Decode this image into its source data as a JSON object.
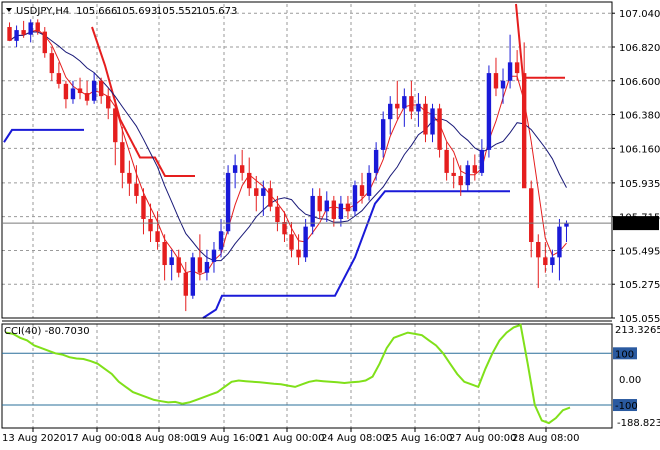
{
  "header": {
    "symbol": "USDJPY,H4",
    "open": "105.666",
    "high": "105.693",
    "low": "105.552",
    "close": "105.673"
  },
  "indicator": {
    "label": "CCI(40) -80.7030",
    "scale_top": "213.3265",
    "scale_bottom": "-188.8236",
    "levels": [
      {
        "text": "100",
        "value": 100,
        "marked": true
      },
      {
        "text": "0.00",
        "value": 0,
        "marked": false
      },
      {
        "text": "-100",
        "value": -100,
        "marked": true
      }
    ]
  },
  "price_axis": {
    "ticks": [
      "107.040",
      "106.820",
      "106.600",
      "106.380",
      "106.160",
      "105.935",
      "105.715",
      "105.495",
      "105.275",
      "105.055"
    ],
    "current_price": "105.673",
    "current_value": 105.673
  },
  "time_axis": {
    "labels": [
      "13 Aug 2020",
      "17 Aug 00:00",
      "18 Aug 08:00",
      "19 Aug 16:00",
      "21 Aug 00:00",
      "24 Aug 08:00",
      "25 Aug 16:00",
      "27 Aug 00:00",
      "28 Aug 08:00"
    ]
  },
  "colors": {
    "bull": "#1a1ad8",
    "bear": "#e51e1e",
    "ma_fast": "#e51e1e",
    "ma_slow": "#1a1a78",
    "stop_red": "#e51e1e",
    "stop_blue": "#1a1ad8",
    "cci": "#80e01a",
    "grid": "#9a9a9a",
    "level_line": "#2a6f9a",
    "marker_bg": "#2a5aa0"
  },
  "chart_data": {
    "type": "candlestick",
    "ylim": [
      105.055,
      107.1
    ],
    "candles": [
      [
        106.95,
        106.98,
        106.9,
        106.86
      ],
      [
        106.86,
        106.96,
        106.82,
        106.93
      ],
      [
        106.93,
        106.99,
        106.88,
        106.9
      ],
      [
        106.9,
        107.0,
        106.85,
        106.98
      ],
      [
        106.98,
        107.0,
        106.9,
        106.92
      ],
      [
        106.92,
        106.95,
        106.75,
        106.78
      ],
      [
        106.78,
        106.82,
        106.6,
        106.65
      ],
      [
        106.65,
        106.72,
        106.55,
        106.58
      ],
      [
        106.58,
        106.6,
        106.42,
        106.48
      ],
      [
        106.48,
        106.6,
        106.45,
        106.55
      ],
      [
        106.55,
        106.62,
        106.48,
        106.52
      ],
      [
        106.52,
        106.6,
        106.44,
        106.47
      ],
      [
        106.47,
        106.65,
        106.45,
        106.6
      ],
      [
        106.6,
        106.62,
        106.45,
        106.5
      ],
      [
        106.5,
        106.55,
        106.35,
        106.42
      ],
      [
        106.42,
        106.48,
        106.05,
        106.2
      ],
      [
        106.2,
        106.3,
        105.9,
        106.0
      ],
      [
        106.0,
        106.08,
        105.85,
        105.93
      ],
      [
        105.93,
        106.05,
        105.8,
        105.85
      ],
      [
        105.85,
        105.9,
        105.6,
        105.7
      ],
      [
        105.7,
        105.8,
        105.55,
        105.62
      ],
      [
        105.62,
        105.75,
        105.5,
        105.55
      ],
      [
        105.55,
        105.6,
        105.3,
        105.4
      ],
      [
        105.4,
        105.5,
        105.3,
        105.45
      ],
      [
        105.45,
        105.5,
        105.32,
        105.35
      ],
      [
        105.35,
        105.42,
        105.1,
        105.2
      ],
      [
        105.2,
        105.48,
        105.18,
        105.45
      ],
      [
        105.45,
        105.6,
        105.3,
        105.35
      ],
      [
        105.35,
        105.5,
        105.3,
        105.42
      ],
      [
        105.42,
        105.55,
        105.35,
        105.5
      ],
      [
        105.5,
        105.7,
        105.45,
        105.62
      ],
      [
        105.62,
        106.05,
        105.6,
        106.0
      ],
      [
        106.0,
        106.12,
        105.9,
        106.05
      ],
      [
        106.05,
        106.15,
        105.95,
        106.0
      ],
      [
        106.0,
        106.1,
        105.85,
        105.9
      ],
      [
        105.9,
        105.98,
        105.75,
        105.85
      ],
      [
        105.85,
        105.95,
        105.72,
        105.9
      ],
      [
        105.9,
        105.95,
        105.75,
        105.78
      ],
      [
        105.78,
        105.85,
        105.62,
        105.68
      ],
      [
        105.68,
        105.75,
        105.55,
        105.6
      ],
      [
        105.6,
        105.68,
        105.45,
        105.5
      ],
      [
        105.5,
        105.6,
        105.4,
        105.45
      ],
      [
        105.45,
        105.7,
        105.42,
        105.65
      ],
      [
        105.65,
        105.9,
        105.6,
        105.85
      ],
      [
        105.85,
        105.9,
        105.7,
        105.75
      ],
      [
        105.75,
        105.88,
        105.68,
        105.82
      ],
      [
        105.82,
        105.85,
        105.65,
        105.7
      ],
      [
        105.7,
        105.85,
        105.65,
        105.8
      ],
      [
        105.8,
        105.85,
        105.7,
        105.75
      ],
      [
        105.75,
        105.95,
        105.72,
        105.92
      ],
      [
        105.92,
        106.0,
        105.8,
        105.85
      ],
      [
        105.85,
        106.05,
        105.82,
        106.0
      ],
      [
        106.0,
        106.2,
        105.95,
        106.15
      ],
      [
        106.15,
        106.4,
        106.1,
        106.35
      ],
      [
        106.35,
        106.5,
        106.25,
        106.45
      ],
      [
        106.45,
        106.6,
        106.35,
        106.42
      ],
      [
        106.42,
        106.55,
        106.3,
        106.5
      ],
      [
        106.5,
        106.6,
        106.35,
        106.4
      ],
      [
        106.4,
        106.52,
        106.3,
        106.45
      ],
      [
        106.45,
        106.5,
        106.2,
        106.25
      ],
      [
        106.25,
        106.45,
        106.2,
        106.42
      ],
      [
        106.42,
        106.45,
        106.1,
        106.15
      ],
      [
        106.15,
        106.2,
        105.95,
        106.0
      ],
      [
        106.0,
        106.1,
        105.9,
        105.98
      ],
      [
        105.98,
        106.05,
        105.85,
        105.92
      ],
      [
        105.92,
        106.08,
        105.88,
        106.05
      ],
      [
        106.05,
        106.12,
        105.95,
        106.0
      ],
      [
        106.0,
        106.22,
        105.98,
        106.15
      ],
      [
        106.15,
        106.7,
        106.1,
        106.65
      ],
      [
        106.65,
        106.75,
        106.5,
        106.55
      ],
      [
        106.55,
        106.68,
        106.45,
        106.6
      ],
      [
        106.6,
        106.9,
        106.55,
        106.72
      ],
      [
        106.72,
        106.8,
        106.6,
        106.65
      ],
      [
        106.65,
        106.85,
        106.3,
        105.9
      ],
      [
        105.9,
        105.95,
        105.45,
        105.55
      ],
      [
        105.55,
        105.6,
        105.25,
        105.45
      ],
      [
        105.45,
        105.55,
        105.35,
        105.4
      ],
      [
        105.4,
        105.5,
        105.35,
        105.45
      ],
      [
        105.45,
        105.7,
        105.3,
        105.65
      ],
      [
        105.65,
        105.69,
        105.55,
        105.67
      ]
    ],
    "cci_values": [
      180,
      175,
      160,
      150,
      130,
      120,
      110,
      100,
      95,
      85,
      80,
      78,
      70,
      60,
      40,
      20,
      -10,
      -30,
      -50,
      -60,
      -70,
      -80,
      -85,
      -90,
      -88,
      -95,
      -90,
      -80,
      -70,
      -60,
      -50,
      -30,
      -10,
      -5,
      -8,
      -10,
      -12,
      -15,
      -18,
      -20,
      -25,
      -30,
      -20,
      -10,
      -5,
      -8,
      -10,
      -12,
      -15,
      -12,
      -10,
      -5,
      10,
      60,
      120,
      160,
      170,
      180,
      175,
      170,
      150,
      130,
      100,
      60,
      20,
      -10,
      -20,
      -30,
      40,
      100,
      150,
      180,
      200,
      210,
      60,
      -100,
      -160,
      -170,
      -150,
      -120,
      -110
    ]
  }
}
